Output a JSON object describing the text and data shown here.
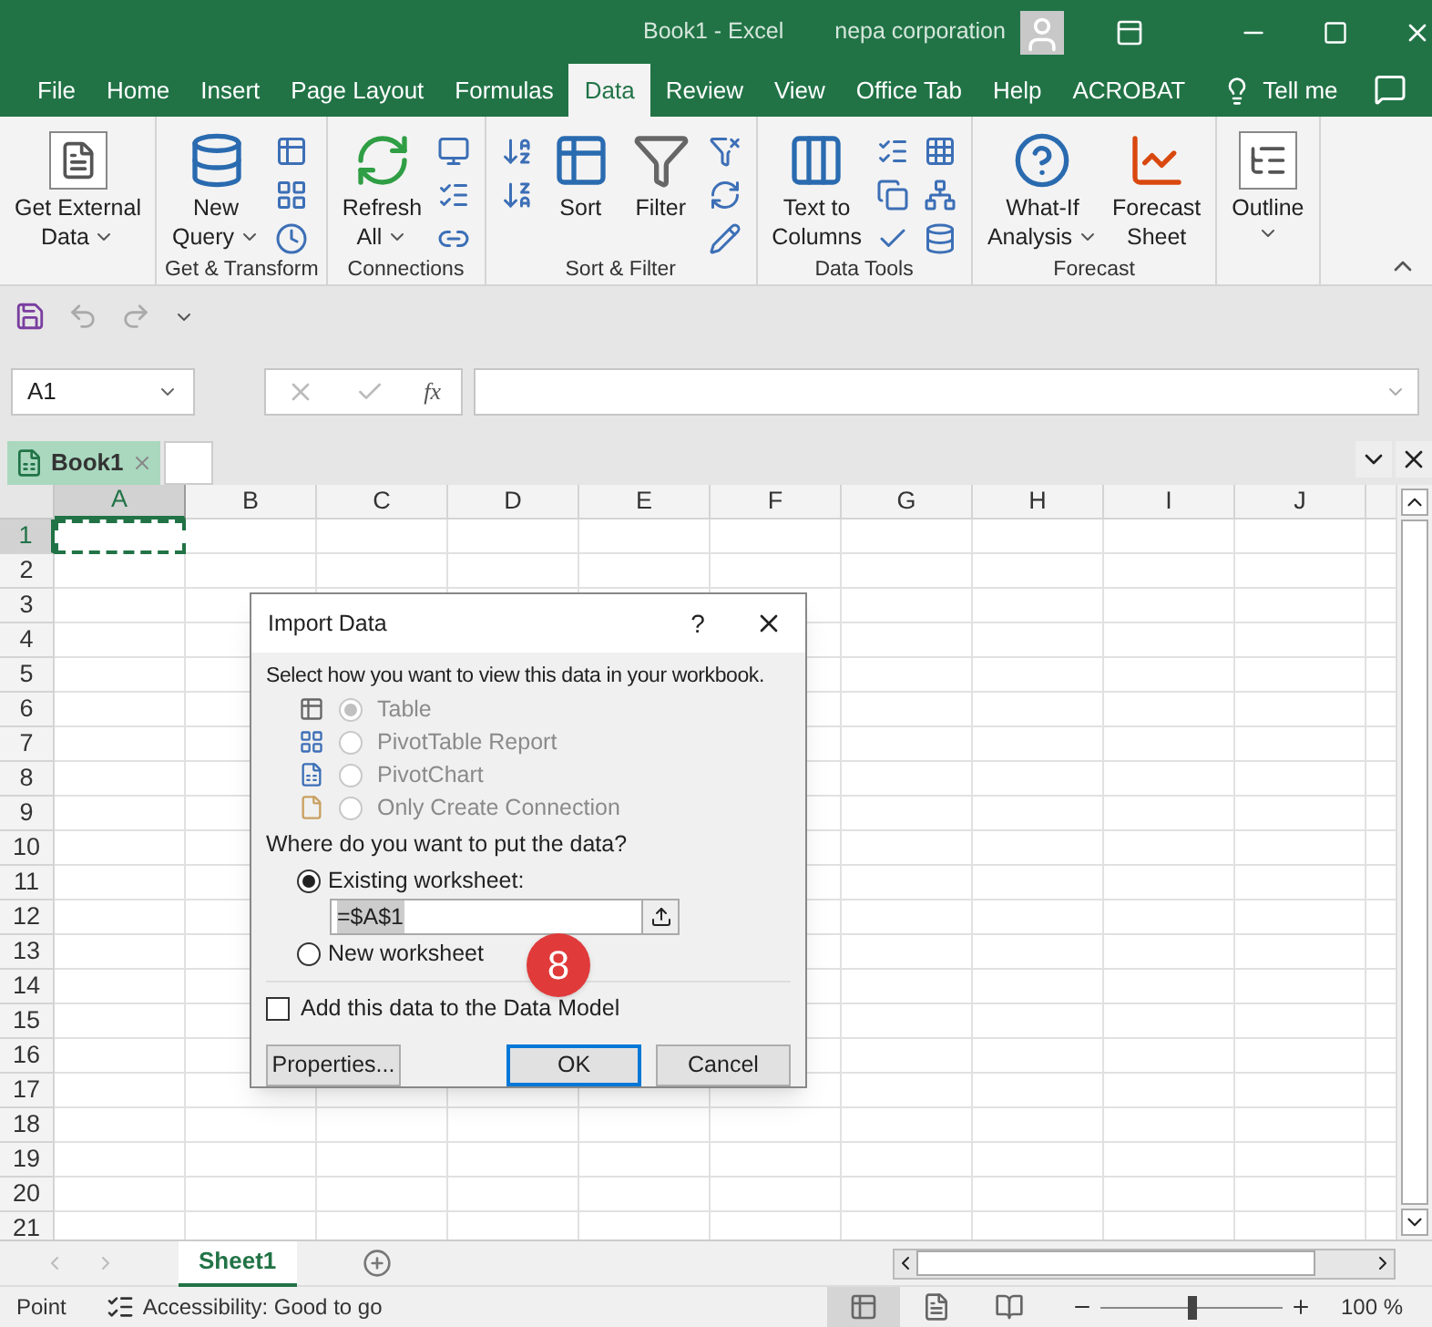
{
  "window": {
    "title": "Book1  -  Excel",
    "user": "nepa corporation"
  },
  "menu_tabs": [
    {
      "label": "File",
      "selected": false
    },
    {
      "label": "Home",
      "selected": false
    },
    {
      "label": "Insert",
      "selected": false
    },
    {
      "label": "Page Layout",
      "selected": false
    },
    {
      "label": "Formulas",
      "selected": false
    },
    {
      "label": "Data",
      "selected": true
    },
    {
      "label": "Review",
      "selected": false
    },
    {
      "label": "View",
      "selected": false
    },
    {
      "label": "Office Tab",
      "selected": false
    },
    {
      "label": "Help",
      "selected": false
    },
    {
      "label": "ACROBAT",
      "selected": false
    }
  ],
  "tell_me": "Tell me",
  "ribbon": {
    "groups": [
      {
        "buttons": [
          {
            "lines": [
              "Get External",
              "Data"
            ],
            "dropdown": true
          }
        ]
      },
      {
        "label": "Get & Transform",
        "buttons": [
          {
            "lines": [
              "New",
              "Query"
            ],
            "dropdown": true
          }
        ]
      },
      {
        "label": "Connections",
        "buttons": [
          {
            "lines": [
              "Refresh",
              "All"
            ],
            "dropdown": true
          }
        ]
      },
      {
        "label": "Sort & Filter",
        "buttons": [
          {
            "lines": [
              "Sort"
            ],
            "dropdown": false
          },
          {
            "lines": [
              "Filter"
            ],
            "dropdown": false
          }
        ]
      },
      {
        "label": "Data Tools",
        "buttons": [
          {
            "lines": [
              "Text to",
              "Columns"
            ],
            "dropdown": false
          }
        ]
      },
      {
        "label": "Forecast",
        "buttons": [
          {
            "lines": [
              "What-If",
              "Analysis"
            ],
            "dropdown": true
          },
          {
            "lines": [
              "Forecast",
              "Sheet"
            ],
            "dropdown": false
          }
        ]
      },
      {
        "buttons": [
          {
            "lines": [
              "Outline"
            ],
            "dropdown": true
          }
        ]
      }
    ]
  },
  "name_box": "A1",
  "function_button": "fx",
  "workbook_tab": "Book1",
  "columns": [
    {
      "label": "A",
      "selected": true
    },
    {
      "label": "B",
      "selected": false
    },
    {
      "label": "C",
      "selected": false
    },
    {
      "label": "D",
      "selected": false
    },
    {
      "label": "E",
      "selected": false
    },
    {
      "label": "F",
      "selected": false
    },
    {
      "label": "G",
      "selected": false
    },
    {
      "label": "H",
      "selected": false
    },
    {
      "label": "I",
      "selected": false
    },
    {
      "label": "J",
      "selected": false
    }
  ],
  "rows": [
    {
      "label": "1",
      "selected": true
    },
    {
      "label": "2",
      "selected": false
    },
    {
      "label": "3",
      "selected": false
    },
    {
      "label": "4",
      "selected": false
    },
    {
      "label": "5",
      "selected": false
    },
    {
      "label": "6",
      "selected": false
    },
    {
      "label": "7",
      "selected": false
    },
    {
      "label": "8",
      "selected": false
    },
    {
      "label": "9",
      "selected": false
    },
    {
      "label": "10",
      "selected": false
    },
    {
      "label": "11",
      "selected": false
    },
    {
      "label": "12",
      "selected": false
    },
    {
      "label": "13",
      "selected": false
    },
    {
      "label": "14",
      "selected": false
    },
    {
      "label": "15",
      "selected": false
    },
    {
      "label": "16",
      "selected": false
    },
    {
      "label": "17",
      "selected": false
    },
    {
      "label": "18",
      "selected": false
    },
    {
      "label": "19",
      "selected": false
    },
    {
      "label": "20",
      "selected": false
    },
    {
      "label": "21",
      "selected": false
    }
  ],
  "dialog": {
    "title": "Import Data",
    "help": "?",
    "prompt": "Select how you want to view this data in your workbook.",
    "view_options": [
      {
        "label": "Table",
        "selected": true,
        "disabled": true
      },
      {
        "label": "PivotTable Report",
        "selected": false,
        "disabled": true
      },
      {
        "label": "PivotChart",
        "selected": false,
        "disabled": true
      },
      {
        "label": "Only Create Connection",
        "selected": false,
        "disabled": true
      }
    ],
    "location_prompt": "Where do you want to put the data?",
    "location_options": [
      {
        "label": "Existing worksheet:",
        "selected": true
      },
      {
        "label": "New worksheet",
        "selected": false
      }
    ],
    "range_value": "=$A$1",
    "data_model": {
      "label": "Add this data to the Data Model",
      "checked": false
    },
    "buttons": [
      {
        "label": "Properties...",
        "default": false
      },
      {
        "label": "OK",
        "default": true
      },
      {
        "label": "Cancel",
        "default": false
      }
    ]
  },
  "step_badge": "8",
  "sheets": [
    {
      "label": "Sheet1",
      "selected": true
    }
  ],
  "status": {
    "mode": "Point",
    "accessibility": "Accessibility: Good to go",
    "views": [
      {
        "selected": true
      },
      {
        "selected": false
      },
      {
        "selected": false
      }
    ],
    "zoom": {
      "level": 0.5,
      "reading": "100 %"
    }
  }
}
